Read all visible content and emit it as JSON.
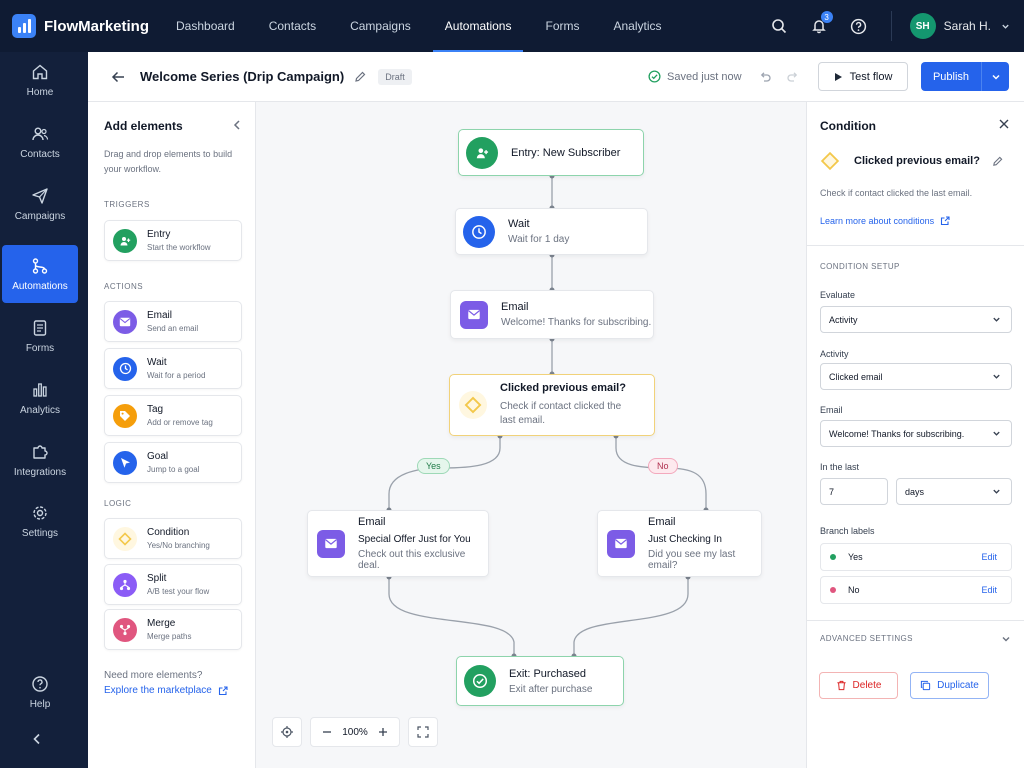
{
  "app": {
    "name": "FlowMarketing"
  },
  "topnav": {
    "items": [
      {
        "label": "Dashboard"
      },
      {
        "label": "Contacts"
      },
      {
        "label": "Campaigns"
      },
      {
        "label": "Automations"
      },
      {
        "label": "Forms"
      },
      {
        "label": "Analytics"
      }
    ],
    "active": "Automations",
    "notification_count": "3",
    "user_initials": "SH",
    "user_name": "Sarah H."
  },
  "rail": {
    "items": [
      {
        "label": "Home"
      },
      {
        "label": "Contacts"
      },
      {
        "label": "Campaigns"
      },
      {
        "label": "Automations"
      },
      {
        "label": "Forms"
      },
      {
        "label": "Analytics"
      },
      {
        "label": "Integrations"
      },
      {
        "label": "Settings"
      }
    ],
    "help_label": "Help"
  },
  "header": {
    "title": "Welcome Series (Drip Campaign)",
    "status": "Draft",
    "saved_text": "Saved just now",
    "test_label": "Test flow",
    "publish_label": "Publish"
  },
  "elements_panel": {
    "title": "Add elements",
    "description": "Drag and drop elements to build your workflow.",
    "sections": {
      "triggers": "TRIGGERS",
      "actions": "ACTIONS",
      "logic": "LOGIC"
    },
    "triggers": [
      {
        "name": "Entry",
        "sub": "Start the workflow"
      }
    ],
    "actions": [
      {
        "name": "Email",
        "sub": "Send an email"
      },
      {
        "name": "Wait",
        "sub": "Wait for a period"
      },
      {
        "name": "Tag",
        "sub": "Add or remove tag"
      },
      {
        "name": "Goal",
        "sub": "Jump to a goal"
      }
    ],
    "logic": [
      {
        "name": "Condition",
        "sub": "Yes/No branching"
      },
      {
        "name": "Split",
        "sub": "A/B test your flow"
      },
      {
        "name": "Merge",
        "sub": "Merge paths"
      }
    ],
    "more_text": "Need more elements?",
    "marketplace_link": "Explore the marketplace"
  },
  "canvas": {
    "nodes": {
      "entry": {
        "title": "Entry: New Subscriber"
      },
      "wait": {
        "title": "Wait",
        "sub": "Wait for 1 day"
      },
      "email1": {
        "title": "Email",
        "sub": "Welcome! Thanks for subscribing."
      },
      "condition": {
        "title": "Clicked previous email?",
        "sub1": "Check if contact clicked the",
        "sub2": "last email."
      },
      "email_yes": {
        "title": "Email",
        "subject": "Special Offer Just for You",
        "sub": "Check out this exclusive deal."
      },
      "email_no": {
        "title": "Email",
        "subject": "Just Checking In",
        "sub": "Did you see my last email?"
      },
      "exit": {
        "title": "Exit: Purchased",
        "sub": "Exit after purchase"
      }
    },
    "branch_yes": "Yes",
    "branch_no": "No",
    "zoom": "100%"
  },
  "properties": {
    "title": "Condition",
    "node_name": "Clicked previous email?",
    "description": "Check if contact clicked the last email.",
    "learn_link": "Learn more about conditions",
    "setup_section": "CONDITION SETUP",
    "evaluate_label": "Evaluate",
    "evaluate_value": "Activity",
    "activity_label": "Activity",
    "activity_value": "Clicked email",
    "email_label": "Email",
    "email_value": "Welcome! Thanks for subscribing.",
    "in_last_label": "In the last",
    "in_last_number": "7",
    "in_last_unit": "days",
    "branch_labels_title": "Branch labels",
    "branch_yes": "Yes",
    "branch_no": "No",
    "edit_label": "Edit",
    "advanced_section": "ADVANCED SETTINGS",
    "delete_label": "Delete",
    "duplicate_label": "Duplicate"
  },
  "colors": {
    "nav_bg": "#0f1b33",
    "accent": "#2563eb",
    "entry_green": "#22a060",
    "wait_blue": "#2563eb",
    "email_purple": "#7c5ce6",
    "tag_orange": "#f59e0b",
    "condition_yellow": "#f3c84b",
    "split_purple": "#8b5cf6",
    "merge_pink": "#e0567f",
    "yes_green": "#22a060",
    "no_red": "#e0567f"
  }
}
